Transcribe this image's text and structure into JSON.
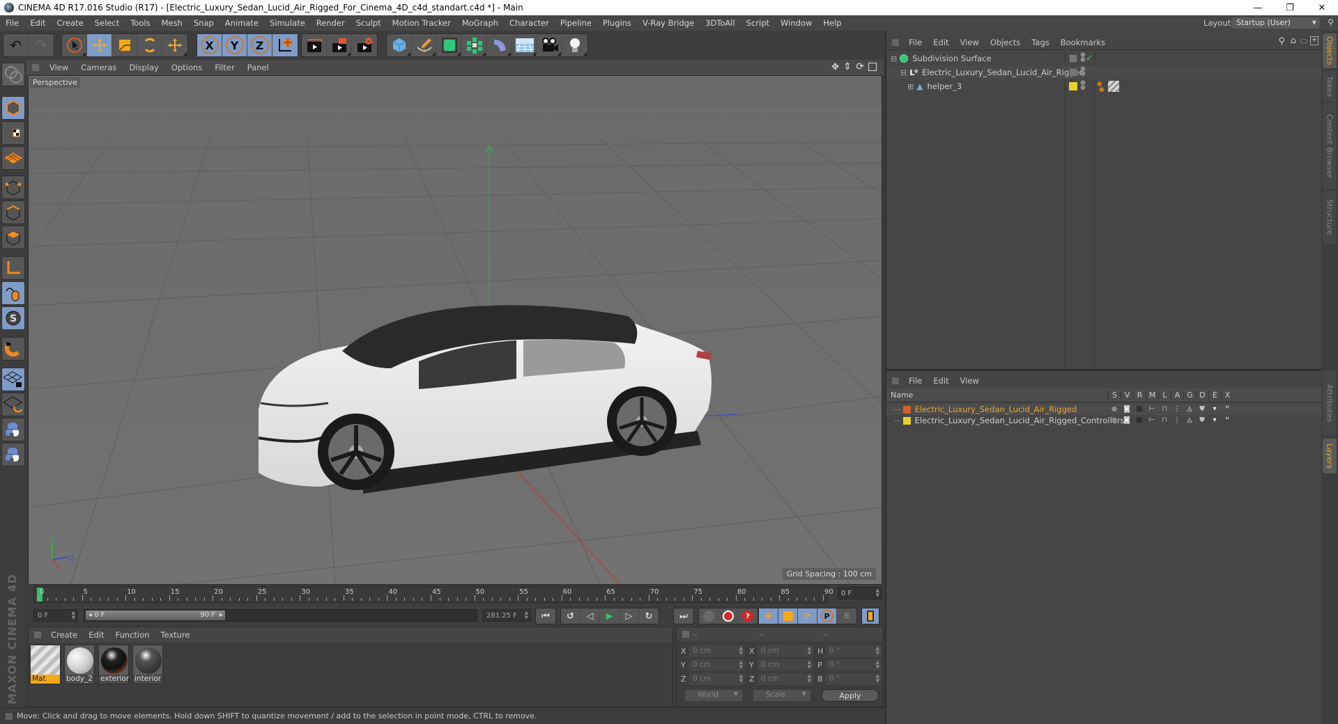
{
  "window": {
    "title": "CINEMA 4D R17.016 Studio (R17) - [Electric_Luxury_Sedan_Lucid_Air_Rigged_For_Cinema_4D_c4d_standart.c4d *] - Main",
    "minimize": "—",
    "maximize": "❐",
    "close": "✕"
  },
  "menubar": {
    "items": [
      "File",
      "Edit",
      "Create",
      "Select",
      "Tools",
      "Mesh",
      "Snap",
      "Animate",
      "Simulate",
      "Render",
      "Sculpt",
      "Motion Tracker",
      "MoGraph",
      "Character",
      "Pipeline",
      "Plugins",
      "V-Ray Bridge",
      "3DToAll",
      "Script",
      "Window",
      "Help"
    ],
    "layout_label": "Layout:",
    "layout_value": "Startup (User)"
  },
  "toolbar": {
    "undo": "undo-icon",
    "redo": "redo-icon",
    "tools": [
      "live-selection-icon",
      "move-icon",
      "scale-icon",
      "rotate-icon",
      "recent-tool-icon"
    ],
    "axes": [
      "X",
      "Y",
      "Z"
    ],
    "coord_system": "world-coordinate-icon",
    "render": [
      "render-view-icon",
      "render-picture-viewer-icon",
      "render-settings-icon"
    ],
    "objects": [
      "cube-icon",
      "pen-spline-icon",
      "subdivision-icon",
      "array-cloner-icon",
      "deformer-bend-icon",
      "floor-scene-icon",
      "camera-icon",
      "light-icon"
    ]
  },
  "left_toolbar": {
    "items": [
      "make-editable-icon",
      "model-mode-icon",
      "texture-mode-icon",
      "workplane-mode-icon",
      "points-mode-icon",
      "edges-mode-icon",
      "polygons-mode-icon",
      "axis-mode-icon",
      "tweak-mode-icon",
      "solo-mode-icon",
      "snapping-icon",
      "lock-workplane-icon",
      "workplane-align-icon",
      "python-icon",
      "python-script-icon"
    ]
  },
  "viewport": {
    "menu": [
      "View",
      "Cameras",
      "Display",
      "Options",
      "Filter",
      "Panel"
    ],
    "camera_label": "Perspective",
    "grid_spacing": "Grid Spacing : 100 cm",
    "nav_icons": [
      "pan-icon",
      "dolly-icon",
      "orbit-icon",
      "maximize-view-icon"
    ],
    "axis_labels": {
      "y": "Y",
      "z": "Z",
      "x": "X"
    }
  },
  "timeline": {
    "ticks": [
      "0",
      "5",
      "10",
      "15",
      "20",
      "25",
      "30",
      "35",
      "40",
      "45",
      "50",
      "55",
      "60",
      "65",
      "70",
      "75",
      "80",
      "85",
      "90"
    ],
    "current_frame": 0,
    "end_frame_field": "0 F",
    "start_field": "0 F",
    "range_start": "0 F",
    "range_end": "90 F",
    "fps_field": "281.25 F"
  },
  "playback": {
    "buttons": [
      "go-to-start-icon",
      "previous-key-icon",
      "previous-frame-icon",
      "play-icon",
      "next-frame-icon",
      "next-key-icon",
      "go-to-end-icon"
    ],
    "record": [
      "motion-record-icon",
      "record-active-icon",
      "autokey-icon"
    ],
    "keytracks": [
      "key-position-icon",
      "key-scale-icon",
      "key-rotation-icon",
      "key-parameter-icon",
      "key-pla-icon"
    ],
    "timeline_button": "timeline-window-icon"
  },
  "materials": {
    "menu": [
      "Create",
      "Edit",
      "Function",
      "Texture"
    ],
    "items": [
      {
        "name": "Mat",
        "selected": true
      },
      {
        "name": "body_2",
        "selected": false
      },
      {
        "name": "exterior",
        "selected": false
      },
      {
        "name": "interior",
        "selected": false
      }
    ],
    "logo": "MAXON CINEMA 4D"
  },
  "coordinates": {
    "headers": [
      "--",
      "--",
      "--"
    ],
    "rows": [
      {
        "l1": "X",
        "v1": "0 cm",
        "l2": "X",
        "v2": "0 cm",
        "l3": "H",
        "v3": "0 °"
      },
      {
        "l1": "Y",
        "v1": "0 cm",
        "l2": "Y",
        "v2": "0 cm",
        "l3": "P",
        "v3": "0 °"
      },
      {
        "l1": "Z",
        "v1": "0 cm",
        "l2": "Z",
        "v2": "0 cm",
        "l3": "B",
        "v3": "0 °"
      }
    ],
    "mode": "World",
    "type": "Scale",
    "apply": "Apply"
  },
  "status": {
    "text": "Move: Click and drag to move elements. Hold down SHIFT to quantize movement / add to the selection in point mode, CTRL to remove."
  },
  "objects": {
    "menu": [
      "File",
      "Edit",
      "View",
      "Objects",
      "Tags",
      "Bookmarks"
    ],
    "rows": [
      {
        "name": "Subdivision Surface",
        "icon": "subdivision-icon",
        "indent": 0,
        "expander": "⊟"
      },
      {
        "name": "Electric_Luxury_Sedan_Lucid_Air_Rigged",
        "icon": "null-object-icon",
        "indent": 1,
        "expander": "⊟"
      },
      {
        "name": "helper_3",
        "icon": "joint-icon",
        "indent": 2,
        "expander": "⊞"
      }
    ]
  },
  "layers": {
    "menu": [
      "File",
      "Edit",
      "View"
    ],
    "columns": [
      "Name",
      "S",
      "V",
      "R",
      "M",
      "L",
      "A",
      "G",
      "D",
      "E",
      "X"
    ],
    "rows": [
      {
        "name": "Electric_Luxury_Sedan_Lucid_Air_Rigged",
        "color": "#d2622a",
        "active": true
      },
      {
        "name": "Electric_Luxury_Sedan_Lucid_Air_Rigged_Controllers",
        "color": "#e6d228",
        "active": false
      }
    ]
  },
  "right_tabs": {
    "top": [
      {
        "label": "Objects",
        "active": true
      },
      {
        "label": "Takes",
        "active": false
      },
      {
        "label": "Content Browser",
        "active": false
      },
      {
        "label": "Structure",
        "active": false
      }
    ],
    "bottom": [
      {
        "label": "Attributes",
        "active": false
      },
      {
        "label": "Layers",
        "active": true
      }
    ]
  },
  "colors": {
    "accent": "#f4a81c",
    "active_tool": "#7f9bc7",
    "playhead": "#29c56a",
    "layer_active_text": "#f0a830"
  }
}
